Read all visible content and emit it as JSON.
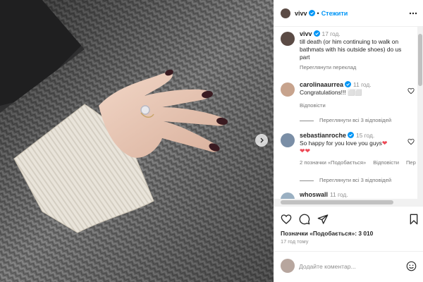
{
  "post": {
    "author": "vivv",
    "follow_label": "Стежити",
    "separator": "•",
    "caption": {
      "username": "vivv",
      "time": "17 год.",
      "text": "till death (or him continuing to walk on bathmats with his outside shoes) do us part",
      "translate_label": "Переглянути переклад"
    },
    "comments": [
      {
        "username": "carolinaaurrea",
        "time": "11 год.",
        "text": "Congratulations!!! ⬜⬜",
        "reply_label": "Відповісти",
        "view_replies": "Переглянути всі 3 відповідей"
      },
      {
        "username": "sebastianroche",
        "time": "15 год.",
        "text": "So happy for you love you guys",
        "hearts_line": "❤❤",
        "likes_label": "2 позначки «Подобається»",
        "reply_label": "Відповісти",
        "more_label": "Пер",
        "view_replies": "Переглянути всі 3 відповідей"
      },
      {
        "username": "whoswall",
        "time": "11 год."
      }
    ],
    "likes_text": "Позначки «Подобається»: 3 010",
    "posted_ago": "17 год тому",
    "comment_placeholder": "Додайте коментар...",
    "icons": {
      "like": "heart-icon",
      "comment": "comment-icon",
      "share": "send-icon",
      "save": "bookmark-icon",
      "emoji": "emoji-icon",
      "more": "more-icon",
      "next": "chevron-right-icon"
    }
  },
  "colors": {
    "link_blue": "#0095f6",
    "verified_blue": "#0095f6",
    "heart_red": "#ed4956",
    "secondary_text": "#8e8e8e"
  }
}
